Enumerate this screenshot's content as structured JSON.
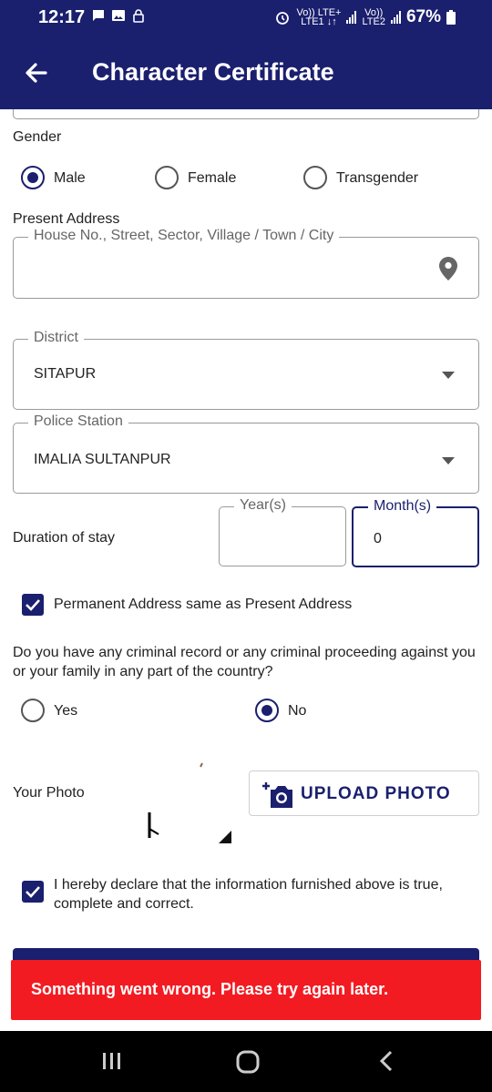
{
  "status_bar": {
    "time": "12:17",
    "network_1": "Vo)) LTE+",
    "network_1_sub": "LTE1 ↓↑",
    "network_2": "Vo))",
    "network_2_sub": "LTE2",
    "battery": "67%"
  },
  "app_bar": {
    "title": "Character Certificate",
    "back_icon": "arrow-left-icon"
  },
  "form": {
    "gender": {
      "label": "Gender",
      "options": [
        {
          "label": "Male",
          "selected": true
        },
        {
          "label": "Female",
          "selected": false
        },
        {
          "label": "Transgender",
          "selected": false
        }
      ]
    },
    "present_address": {
      "label": "Present Address",
      "address_field_label": "House No., Street, Sector, Village / Town / City",
      "address_value": "",
      "location_icon": "location-pin-icon"
    },
    "district": {
      "label": "District",
      "value": "SITAPUR"
    },
    "police_station": {
      "label": "Police Station",
      "value": "IMALIA SULTANPUR"
    },
    "duration": {
      "label": "Duration of stay",
      "years_label": "Year(s)",
      "years_value": "",
      "months_label": "Month(s)",
      "months_value": "0"
    },
    "permanent_same": {
      "label": "Permanent Address same as Present Address",
      "checked": true
    },
    "criminal_record": {
      "question": "Do you have any criminal record or any criminal proceeding against you or your family in any part of the country?",
      "options": [
        {
          "label": "Yes",
          "selected": false
        },
        {
          "label": "No",
          "selected": true
        }
      ]
    },
    "photo": {
      "label": "Your Photo",
      "upload_label": "UPLOAD PHOTO",
      "camera_icon": "camera-plus-icon"
    },
    "declaration": {
      "label": "I hereby declare that the information furnished above is true, complete and correct.",
      "checked": true
    }
  },
  "snackbar": {
    "message": "Something went wrong. Please try again later.",
    "color": "#f31b22"
  },
  "nav_bar": {
    "recents_icon": "recents-icon",
    "home_icon": "home-icon",
    "back_icon": "back-chevron-icon"
  },
  "colors": {
    "primary": "#1a1f6e",
    "error": "#f31b22"
  }
}
